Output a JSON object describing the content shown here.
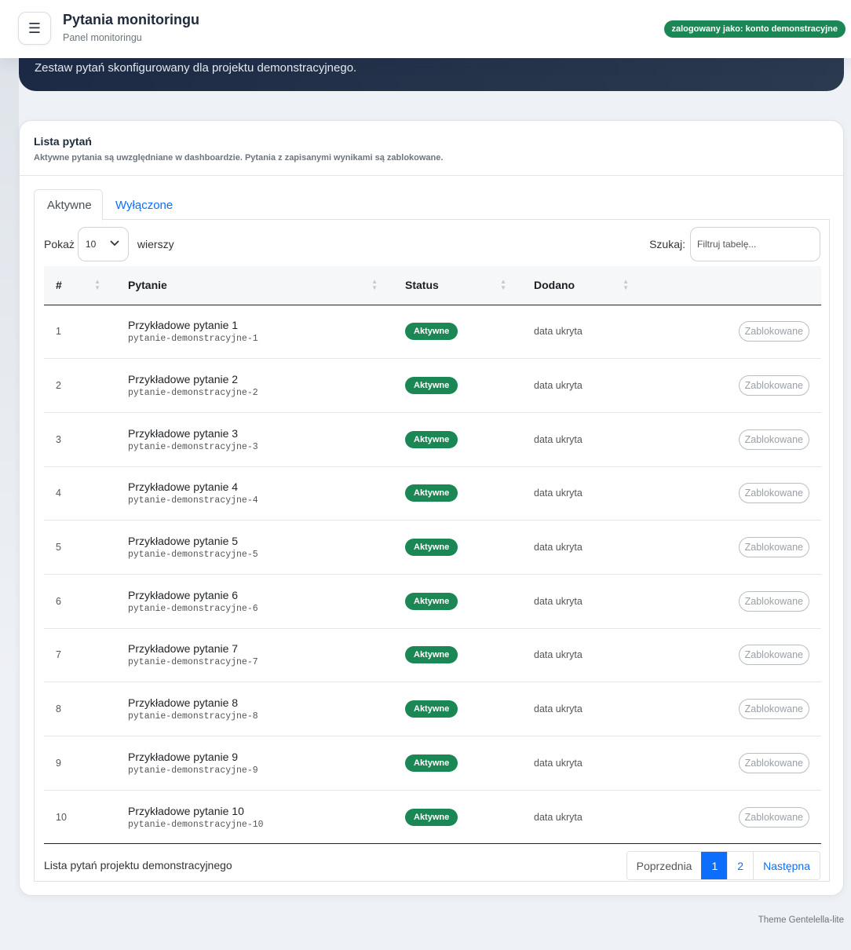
{
  "header": {
    "title": "Pytania monitoringu",
    "subtitle": "Panel monitoringu",
    "menu_icon": "☰",
    "user_badge": "zalogowany jako: konto demonstracyjne"
  },
  "banner": {
    "text": "Zestaw pytań skonfigurowany dla projektu demonstracyjnego."
  },
  "card": {
    "title": "Lista pytań",
    "subtitle": "Aktywne pytania są uwzględniane w dashboardzie. Pytania z zapisanymi wynikami są zablokowane."
  },
  "tabs": [
    {
      "label": "Aktywne"
    },
    {
      "label": "Wyłączone"
    }
  ],
  "controls": {
    "show_label": "Pokaż",
    "show_value": "10",
    "rows_label": "wierszy",
    "search_label": "Szukaj:",
    "search_placeholder": "Filtruj tabelę..."
  },
  "table": {
    "headers": [
      "#",
      "Pytanie",
      "Status",
      "Dodano"
    ],
    "rows": [
      {
        "n": "1",
        "title": "Przykładowe pytanie 1",
        "slug": "pytanie-demonstracyjne-1",
        "status": "Aktywne",
        "added": "data ukryta",
        "action": "Zablokowane"
      },
      {
        "n": "2",
        "title": "Przykładowe pytanie 2",
        "slug": "pytanie-demonstracyjne-2",
        "status": "Aktywne",
        "added": "data ukryta",
        "action": "Zablokowane"
      },
      {
        "n": "3",
        "title": "Przykładowe pytanie 3",
        "slug": "pytanie-demonstracyjne-3",
        "status": "Aktywne",
        "added": "data ukryta",
        "action": "Zablokowane"
      },
      {
        "n": "4",
        "title": "Przykładowe pytanie 4",
        "slug": "pytanie-demonstracyjne-4",
        "status": "Aktywne",
        "added": "data ukryta",
        "action": "Zablokowane"
      },
      {
        "n": "5",
        "title": "Przykładowe pytanie 5",
        "slug": "pytanie-demonstracyjne-5",
        "status": "Aktywne",
        "added": "data ukryta",
        "action": "Zablokowane"
      },
      {
        "n": "6",
        "title": "Przykładowe pytanie 6",
        "slug": "pytanie-demonstracyjne-6",
        "status": "Aktywne",
        "added": "data ukryta",
        "action": "Zablokowane"
      },
      {
        "n": "7",
        "title": "Przykładowe pytanie 7",
        "slug": "pytanie-demonstracyjne-7",
        "status": "Aktywne",
        "added": "data ukryta",
        "action": "Zablokowane"
      },
      {
        "n": "8",
        "title": "Przykładowe pytanie 8",
        "slug": "pytanie-demonstracyjne-8",
        "status": "Aktywne",
        "added": "data ukryta",
        "action": "Zablokowane"
      },
      {
        "n": "9",
        "title": "Przykładowe pytanie 9",
        "slug": "pytanie-demonstracyjne-9",
        "status": "Aktywne",
        "added": "data ukryta",
        "action": "Zablokowane"
      },
      {
        "n": "10",
        "title": "Przykładowe pytanie 10",
        "slug": "pytanie-demonstracyjne-10",
        "status": "Aktywne",
        "added": "data ukryta",
        "action": "Zablokowane"
      }
    ],
    "info": "Lista pytań projektu demonstracyjnego"
  },
  "pagination": {
    "prev": "Poprzednia",
    "pages": [
      "1",
      "2"
    ],
    "next": "Następna"
  },
  "footer": {
    "credit": "Theme Gentelella-lite"
  },
  "colors": {
    "accent": "#0d6efd",
    "success": "#1a8754",
    "banner": "#1c2a45"
  }
}
